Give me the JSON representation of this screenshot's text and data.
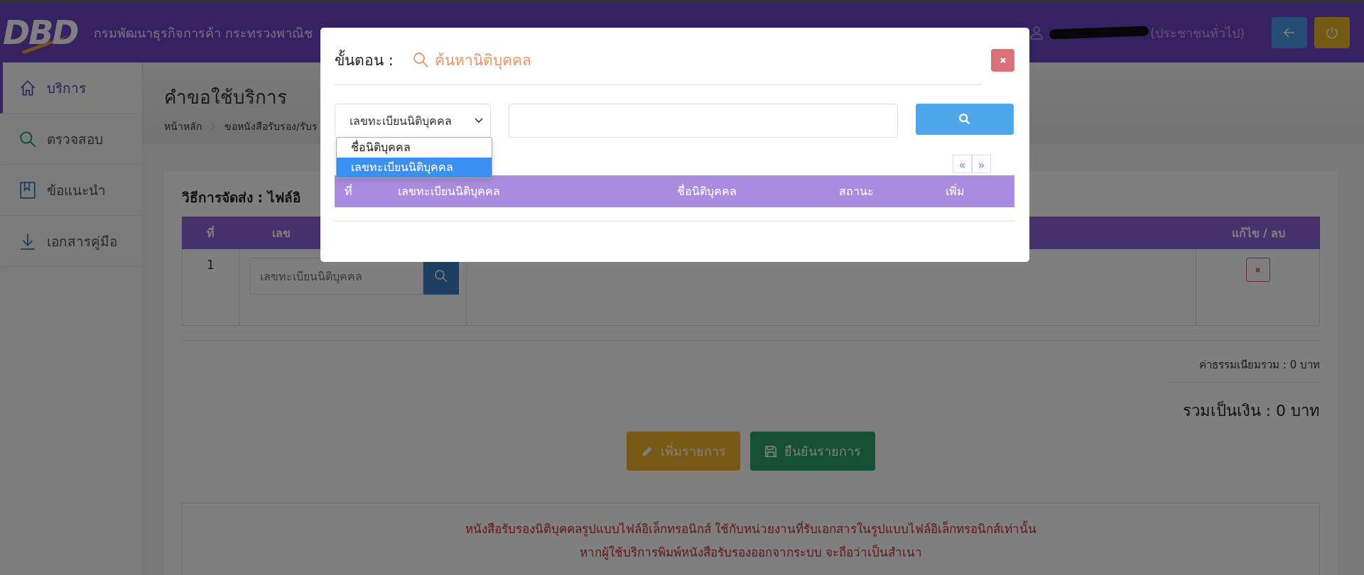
{
  "header": {
    "logo": "DBD",
    "org_name": "กรมพัฒนาธุรกิจการค้า กระทรวงพาณิช",
    "user_role": "(ประชาชนทั่วไป)"
  },
  "sidebar": {
    "items": [
      {
        "label": "บริการ",
        "selected": true
      },
      {
        "label": "ตรวจสอบ",
        "selected": false
      },
      {
        "label": "ข้อแนะนำ",
        "selected": false
      },
      {
        "label": "เอกสารคู่มือ",
        "selected": false
      }
    ]
  },
  "page": {
    "title": "คำขอใช้บริการ",
    "breadcrumb": [
      "หน้าหลัก",
      "ขอหนังสือรับรอง/รับร"
    ]
  },
  "delivery": {
    "heading": "วิธีการจัดส่ง : ไฟล์อิ",
    "columns": [
      "ที่",
      "เลข",
      "แก้ไข / ลบ"
    ],
    "rows": [
      {
        "number": "1",
        "placeholder": "เลขทะเบียนนิติบุคคล"
      }
    ]
  },
  "fee_total": "ค่าธรรมเนียมรวม : 0 บาท",
  "grand_total": "รวมเป็นเงิน : 0 บาท",
  "buttons": [
    {
      "label": "เพิ่มรายการ",
      "kind": "add"
    },
    {
      "label": "ยืนยันรายการ",
      "kind": "confirm"
    }
  ],
  "notice": [
    "หนังสือรับรองนิติบุคคลรูปแบบไฟล์อิเล็กทรอนิกส์ ใช้กับหน่วยงานที่รับเอกสารในรูปแบบไฟล์อิเล็กทรอนิกส์เท่านั้น",
    "หากผู้ใช้บริการพิมพ์หนังสือรับรองออกจากระบบ จะถือว่าเป็นสำเนา"
  ],
  "modal": {
    "step_label": "ขั้นตอน :",
    "step_title": "ค้นหานิติบุคคล",
    "select": {
      "value": "เลขทะเบียนนิติบุคคล",
      "options": [
        {
          "label": "ชื่อนิติบุคคล",
          "selected": false
        },
        {
          "label": "เลขทะเบียนนิติบุคคล",
          "selected": true
        }
      ]
    },
    "pager": [
      "«",
      "»"
    ],
    "columns": [
      "ที่",
      "เลขทะเบียนนิติบุคคล",
      "ชื่อนิติบุคคล",
      "สถานะ",
      "เพิ่ม"
    ]
  }
}
